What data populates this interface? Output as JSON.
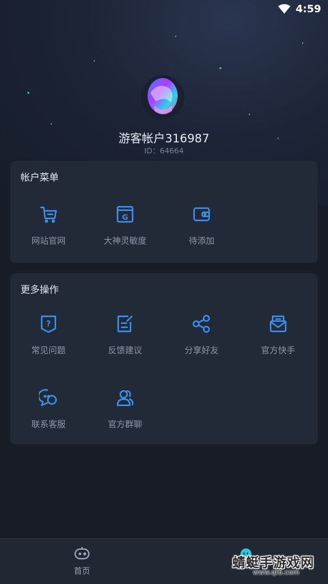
{
  "status_bar": {
    "time": "4:59"
  },
  "profile": {
    "username": "游客帐户316987",
    "id_text": "ID：64664"
  },
  "account_menu": {
    "title": "帐户菜单",
    "items": [
      {
        "label": "网站官网",
        "icon": "cart-icon"
      },
      {
        "label": "大神灵敏度",
        "icon": "g-window-icon"
      },
      {
        "label": "待添加",
        "icon": "wallet-icon"
      }
    ]
  },
  "more_actions": {
    "title": "更多操作",
    "items": [
      {
        "label": "常见问题",
        "icon": "question-icon"
      },
      {
        "label": "反馈建议",
        "icon": "feedback-icon"
      },
      {
        "label": "分享好友",
        "icon": "share-icon"
      },
      {
        "label": "官方快手",
        "icon": "mail-icon"
      },
      {
        "label": "联系客服",
        "icon": "chat-icon"
      },
      {
        "label": "官方群聊",
        "icon": "group-icon"
      }
    ]
  },
  "tabbar": {
    "home_label": "首页"
  },
  "watermark": {
    "text": "蜻蜓手游戏网",
    "url": "www.qt6.com"
  },
  "colors": {
    "accent": "#3a8ff0",
    "card": "#232a37",
    "background": "#181c26"
  }
}
